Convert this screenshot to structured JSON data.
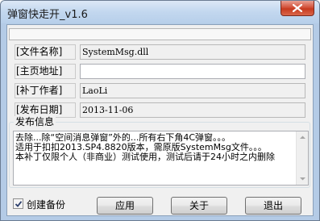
{
  "window": {
    "title": "弹窗快走开_v1.6"
  },
  "fields": [
    {
      "label": "[文件名称]",
      "value": "SystemMsg.dll"
    },
    {
      "label": "[主页地址]",
      "value": ""
    },
    {
      "label": "[补丁作者]",
      "value": "LaoLi"
    },
    {
      "label": "[发布日期]",
      "value": "2013-11-06"
    }
  ],
  "description": {
    "title": "发布信息",
    "lines": [
      "去除...除“空间消息弹窗”外的...所有右下角4C弹窗。。。",
      "适用于扣扣2013.SP4.8820版本，需原版SystemMsg文件。。。",
      "本补丁仅限个人（非商业）测试使用，测试后请于24小时之内删除"
    ]
  },
  "footer": {
    "backup_label": "创建备份",
    "backup_checked": true,
    "apply_label": "应用",
    "about_label": "关于",
    "exit_label": "退出"
  },
  "icons": {
    "close": "close-icon",
    "check": "check-icon",
    "scroll_up": "scroll-up-arrow-icon",
    "scroll_down": "scroll-down-arrow-icon"
  },
  "colors": {
    "title_bar": "#c2d7ef",
    "close_button": "#c73a1f",
    "client_bg": "#f0f0f0"
  }
}
